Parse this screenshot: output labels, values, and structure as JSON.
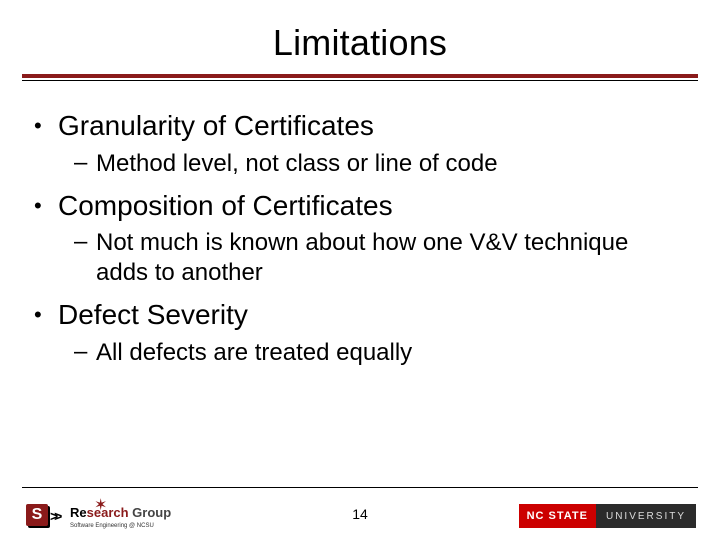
{
  "title": "Limitations",
  "bullets": [
    {
      "text": "Granularity of Certificates",
      "sub": [
        "Method level, not class or line of code"
      ]
    },
    {
      "text": "Composition of Certificates",
      "sub": [
        "Not much is known about how one V&V technique adds to another"
      ]
    },
    {
      "text": "Defect Severity",
      "sub": [
        "All defects are treated equally"
      ]
    }
  ],
  "page_number": "14",
  "logo_left": {
    "badge": "S",
    "chev": ">>",
    "line1_a": "Re",
    "line1_b": "search",
    "line1_c": " Group",
    "line2": "Software Engineering @ NCSU"
  },
  "logo_right": {
    "red": "NC STATE",
    "dark": "UNIVERSITY"
  }
}
